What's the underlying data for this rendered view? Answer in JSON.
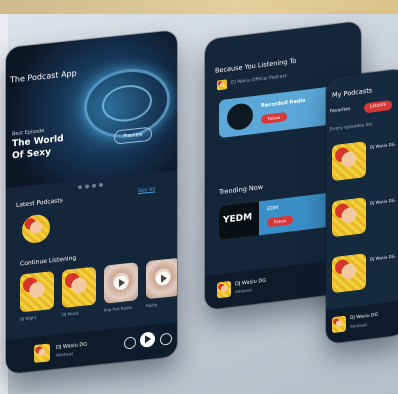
{
  "phone1": {
    "app_title": "The Podcast App",
    "hero_kicker": "Best Episode",
    "hero_title_line1": "The World",
    "hero_title_line2": "Of Sexy",
    "hero_button": "Preview",
    "section_latest": "Latest Podcasts",
    "see_all": "See All",
    "section_continue": "Continue Listening",
    "continue_items": [
      "DJ Night",
      "DJ Music",
      "Pop Hot Radio",
      "Radio"
    ],
    "player_title": "DJ Wasiu DG",
    "player_sub": "Afrobeat"
  },
  "phone2": {
    "section_because": "Because You Listening To",
    "because_name": "DJ Wasiu Official Podcast",
    "featured_title": "Recorded Radio",
    "featured_button": "Follow",
    "section_trending": "Trending Now",
    "trending_title": "EDM",
    "trending_button": "Follow",
    "trending_logo": "YEDM",
    "player_title": "DJ Wasiu DG",
    "player_sub": "Afrobeat"
  },
  "phone3": {
    "header": "My Podcasts",
    "tab_favorites": "Favorites",
    "tab_latest": "Latests",
    "subheading": "Every episodes list",
    "items": [
      "DJ Wasiu DG",
      "DJ Wasiu DG",
      "DJ Wasiu DG"
    ],
    "player_title": "DJ Wasiu DG",
    "player_sub": "Afrobeat"
  },
  "colors": {
    "accent": "#3fa6e8",
    "red": "#d8383a",
    "panel": "#14263a"
  }
}
